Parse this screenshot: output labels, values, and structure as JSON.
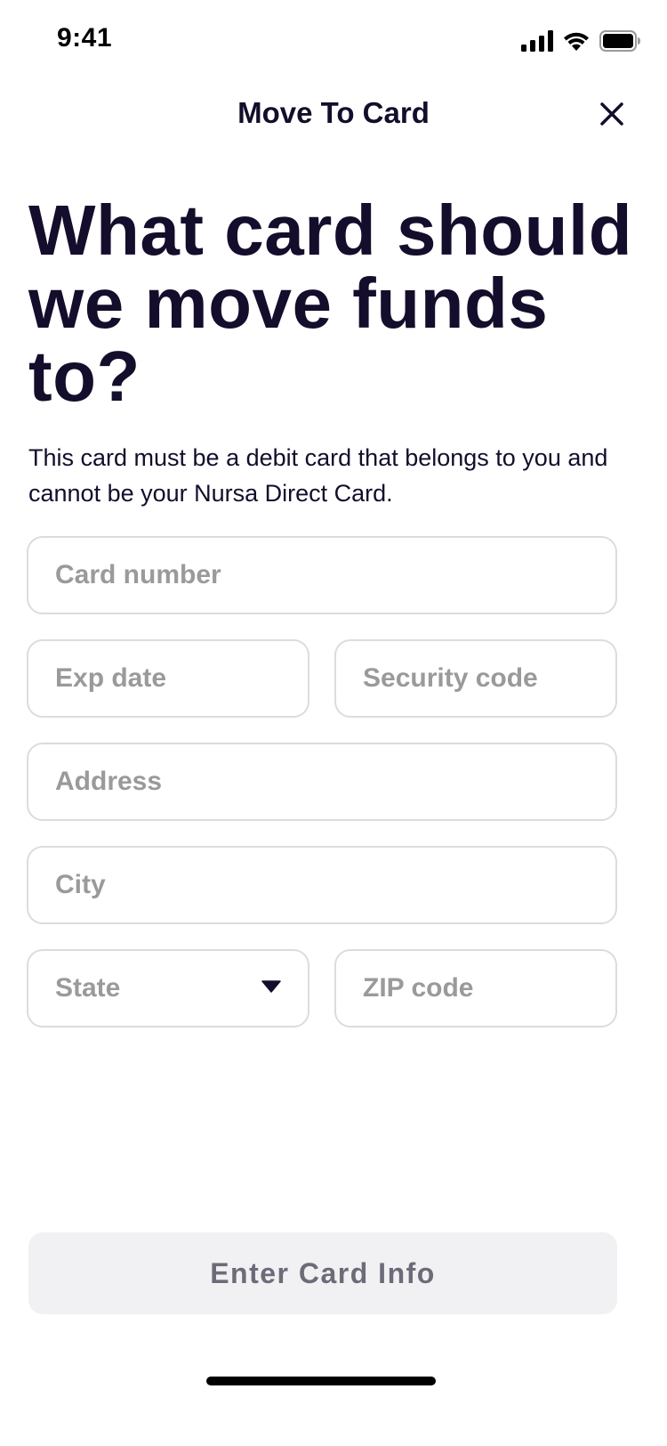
{
  "status_bar": {
    "time": "9:41",
    "icons": [
      "cellular-signal-icon",
      "wifi-icon",
      "battery-icon"
    ]
  },
  "nav": {
    "title": "Move To Card",
    "close_icon": "close-icon"
  },
  "headline": "What card should we move funds to?",
  "subtext": "This card must be a debit card that belongs to you and cannot be your Nursa Direct Card.",
  "form": {
    "card_number": {
      "placeholder": "Card number",
      "value": ""
    },
    "exp_date": {
      "placeholder": "Exp date",
      "value": ""
    },
    "security_code": {
      "placeholder": "Security code",
      "value": ""
    },
    "address": {
      "placeholder": "Address",
      "value": ""
    },
    "city": {
      "placeholder": "City",
      "value": ""
    },
    "state": {
      "placeholder": "State",
      "value": ""
    },
    "zip_code": {
      "placeholder": "ZIP code",
      "value": ""
    }
  },
  "submit_button": {
    "label": "Enter Card Info",
    "state": "disabled"
  },
  "colors": {
    "text_primary": "#140d2b",
    "placeholder": "#9a9a9c",
    "field_border": "#dcdcde",
    "button_bg": "#f1f1f4",
    "button_text": "#6e6b79"
  }
}
